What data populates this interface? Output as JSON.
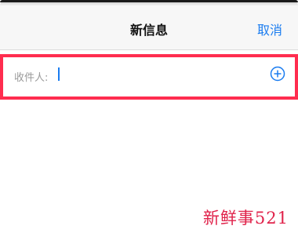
{
  "nav": {
    "title": "新信息",
    "cancel_label": "取消"
  },
  "recipient": {
    "label": "收件人:",
    "value": "",
    "add_icon": "plus-circle-icon"
  },
  "watermark": {
    "text": "新鲜事521"
  },
  "colors": {
    "accent": "#1a7cf0",
    "highlight_border": "#ff2d4f",
    "watermark": "#e0224a"
  }
}
